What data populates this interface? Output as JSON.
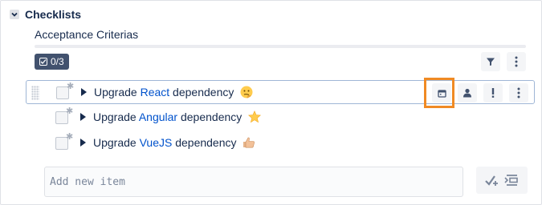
{
  "section": {
    "title": "Checklists",
    "checklist_name": "Acceptance Criterias",
    "progress_fraction": 0,
    "count_label": "0/3"
  },
  "items": [
    {
      "prefix": "Upgrade ",
      "link": "React",
      "suffix": " dependency",
      "emoji": "thinking-face",
      "active": true
    },
    {
      "prefix": "Upgrade ",
      "link": "Angular",
      "suffix": " dependency",
      "emoji": "star",
      "active": false
    },
    {
      "prefix": "Upgrade ",
      "link": "VueJS",
      "suffix": " dependency",
      "emoji": "thumbs-up",
      "active": false
    }
  ],
  "add_item": {
    "placeholder": "Add new item",
    "value": ""
  },
  "colors": {
    "accent": "#0052cc",
    "highlight": "#f08a24",
    "badge": "#42526e"
  }
}
